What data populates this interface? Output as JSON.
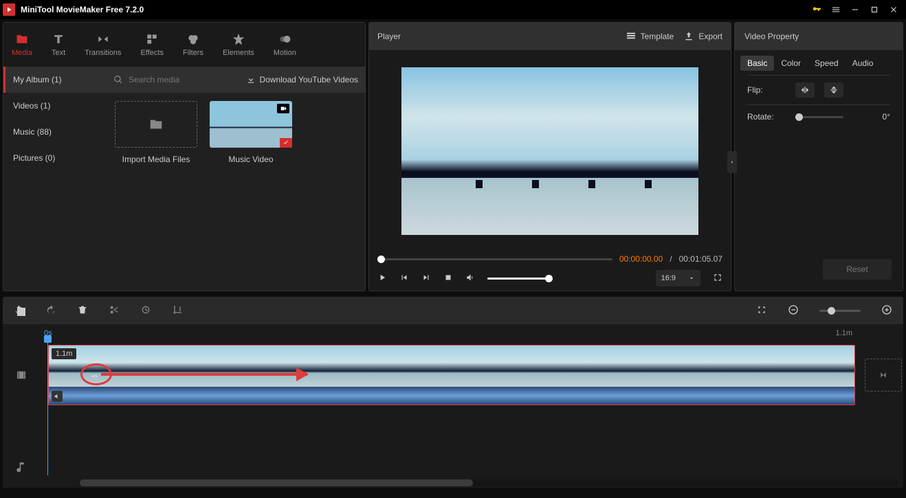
{
  "titlebar": {
    "app_title": "MiniTool MovieMaker Free 7.2.0"
  },
  "tabs": {
    "media": "Media",
    "text": "Text",
    "transitions": "Transitions",
    "effects": "Effects",
    "filters": "Filters",
    "elements": "Elements",
    "motion": "Motion"
  },
  "sidebar": {
    "my_album": "My Album (1)",
    "videos": "Videos (1)",
    "music": "Music (88)",
    "pictures": "Pictures (0)"
  },
  "content": {
    "search_placeholder": "Search media",
    "download_link": "Download YouTube Videos",
    "import_label": "Import Media Files",
    "clip_label": "Music Video"
  },
  "player": {
    "label": "Player",
    "template": "Template",
    "export": "Export",
    "time_current": "00:00:00.00",
    "time_total": "00:01:05.07",
    "aspect": "16:9"
  },
  "properties": {
    "title": "Video Property",
    "tab_basic": "Basic",
    "tab_color": "Color",
    "tab_speed": "Speed",
    "tab_audio": "Audio",
    "flip": "Flip:",
    "rotate": "Rotate:",
    "rotate_value": "0°",
    "reset": "Reset"
  },
  "timeline": {
    "ruler_start": "0s",
    "ruler_end": "1.1m",
    "clip_duration": "1.1m"
  }
}
